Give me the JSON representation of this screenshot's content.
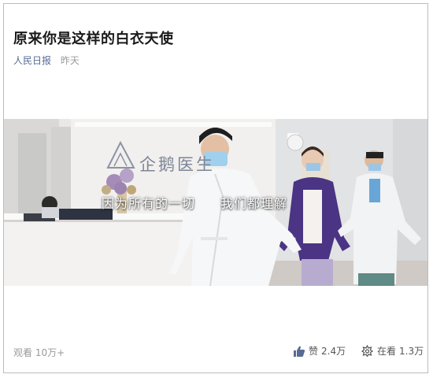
{
  "article": {
    "title": "原来你是这样的白衣天使",
    "source": "人民日报",
    "time": "昨天"
  },
  "video": {
    "scene_brand": "企鹅医生",
    "caption_part1": "因为所有的一切",
    "caption_part2": "我们都理解"
  },
  "footer": {
    "views_label": "观看 10万+",
    "like_label": "赞",
    "like_count": "2.4万",
    "watching_label": "在看",
    "watching_count": "1.3万"
  },
  "colors": {
    "source_link": "#576b95",
    "muted_text": "#9a9a9a",
    "like_icon": "#576b95"
  }
}
